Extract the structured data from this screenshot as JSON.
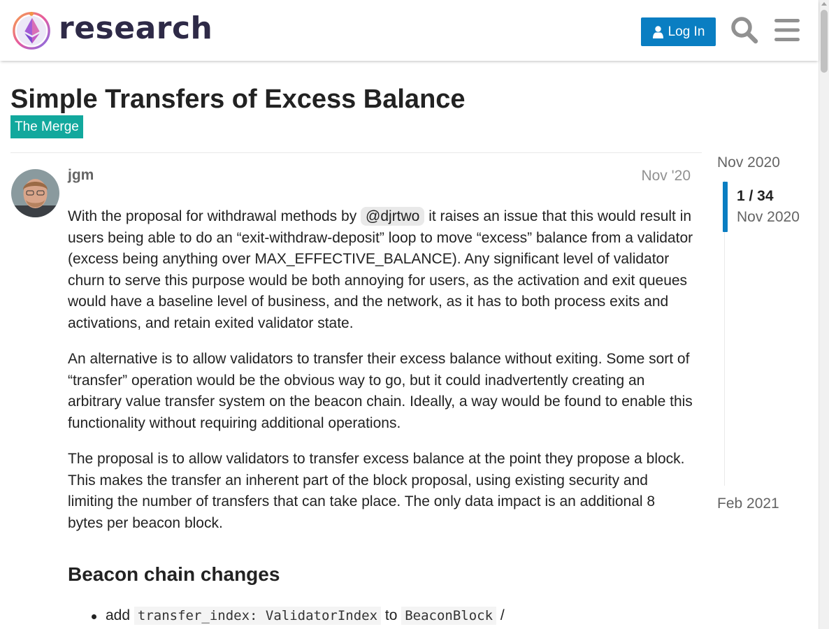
{
  "header": {
    "site_name": "research",
    "login_label": "Log In"
  },
  "topic": {
    "title": "Simple Transfers of Excess Balance",
    "category": "The Merge",
    "category_color": "#12a89d"
  },
  "post": {
    "author": "jgm",
    "date": "Nov '20",
    "p1_before": "With the proposal for withdrawal methods by ",
    "p1_mention": "@djrtwo",
    "p1_after": " it raises an issue that this would result in users being able to do an “exit-withdraw-deposit” loop to move “excess” balance from a validator (excess being anything over MAX_EFFECTIVE_BALANCE). Any significant level of validator churn to serve this purpose would be both annoying for users, as the activation and exit queues would have a baseline level of business, and the network, as it has to both process exits and activations, and retain exited validator state.",
    "p2": "An alternative is to allow validators to transfer their excess balance without exiting. Some sort of “transfer” operation would be the obvious way to go, but it could inadvertently creating an arbitrary value transfer system on the beacon chain. Ideally, a way would be found to enable this functionality without requiring additional operations.",
    "p3": "The proposal is to allow validators to transfer excess balance at the point they propose a block. This makes the transfer an inherent part of the block proposal, using existing security and limiting the number of transfers that can take place. The only data impact is an additional 8 bytes per beacon block.",
    "heading": "Beacon chain changes",
    "list": [
      {
        "prefix": "add ",
        "code1": "transfer_index: ValidatorIndex",
        "middle": " to ",
        "code2": "BeaconBlock",
        "suffix": " /"
      }
    ]
  },
  "timeline": {
    "start": "Nov 2020",
    "position": "1 / 34",
    "current_date": "Nov 2020",
    "end": "Feb 2021",
    "accent_color": "#0a7ec2"
  }
}
